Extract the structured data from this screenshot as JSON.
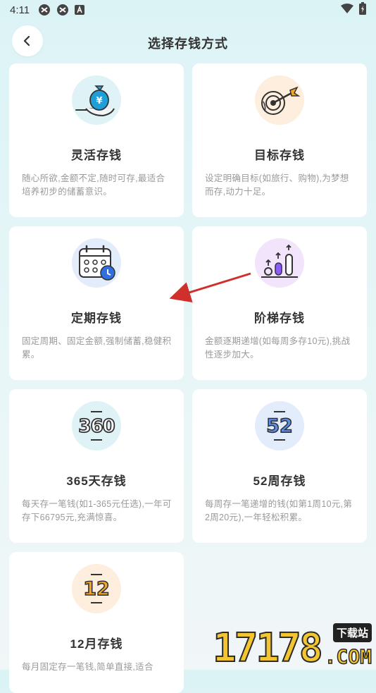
{
  "status_bar": {
    "time": "4:11"
  },
  "header": {
    "title": "选择存钱方式"
  },
  "cards": [
    {
      "title": "灵活存钱",
      "desc": "随心所欲,金额不定,随时可存,最适合培养初步的储蓄意识。",
      "icon": "money-bag-hand-icon"
    },
    {
      "title": "目标存钱",
      "desc": "设定明确目标(如旅行、购物),为梦想而存,动力十足。",
      "icon": "target-dart-icon"
    },
    {
      "title": "定期存钱",
      "desc": "固定周期、固定金额,强制储蓄,稳健积累。",
      "icon": "calendar-clock-icon"
    },
    {
      "title": "阶梯存钱",
      "desc": "金额逐期递增(如每周多存10元),挑战性逐步加大。",
      "icon": "growth-bars-icon"
    },
    {
      "title": "365天存钱",
      "desc": "每天存一笔钱(如1-365元任选),一年可存下66795元,充满惊喜。",
      "icon": "number-360-icon",
      "icon_text": "360"
    },
    {
      "title": "52周存钱",
      "desc": "每周存一笔递增的钱(如第1周10元,第2周20元),一年轻松积累。",
      "icon": "number-52-icon",
      "icon_text": "52"
    },
    {
      "title": "12月存钱",
      "desc": "每月固定存一笔钱,简单直接,适合",
      "icon": "number-12-icon",
      "icon_text": "12"
    }
  ],
  "watermark": {
    "number": "17178",
    "cn": "下载站",
    "com": ".COM"
  },
  "colors": {
    "accent_blue": "#2f6fe0",
    "accent_orange": "#f5a623",
    "accent_purple": "#8b5cf6",
    "arrow_red": "#d0302b"
  }
}
